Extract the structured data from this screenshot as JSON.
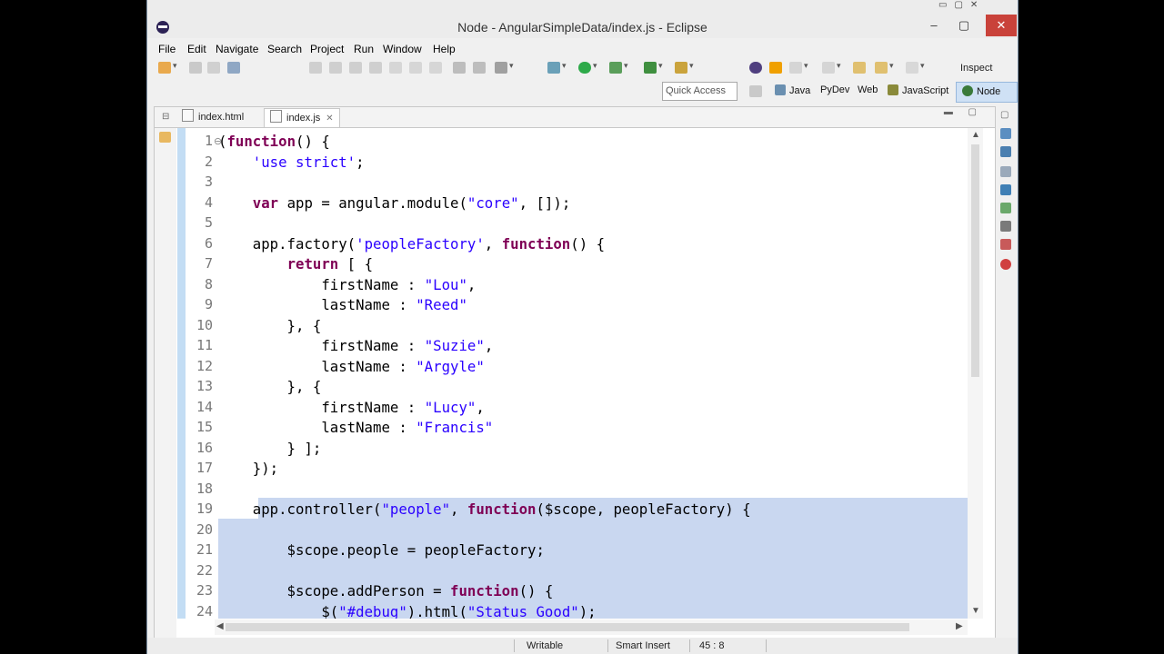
{
  "window": {
    "title": "Node - AngularSimpleData/index.js - Eclipse"
  },
  "menu": [
    "File",
    "Edit",
    "Navigate",
    "Search",
    "Project",
    "Run",
    "Window",
    "Help"
  ],
  "toolbar": {
    "inspect_label": "Inspect",
    "quick_access_placeholder": "Quick Access",
    "perspectives": [
      "Java",
      "PyDev",
      "Web",
      "JavaScript",
      "Node"
    ],
    "active_perspective": "Node"
  },
  "editor": {
    "tabs": [
      "index.html",
      "index.js"
    ],
    "active_tab": "index.js",
    "line_numbers": [
      "1",
      "2",
      "3",
      "4",
      "5",
      "6",
      "7",
      "8",
      "9",
      "10",
      "11",
      "12",
      "13",
      "14",
      "15",
      "16",
      "17",
      "18",
      "19",
      "20",
      "21",
      "22",
      "23",
      "24"
    ],
    "code_lines": [
      "(function() {",
      "    'use strict';",
      "",
      "    var app = angular.module(\"core\", []);",
      "",
      "    app.factory('peopleFactory', function() {",
      "        return [ {",
      "            firstName : \"Lou\",",
      "            lastName : \"Reed\"",
      "        }, {",
      "            firstName : \"Suzie\",",
      "            lastName : \"Argyle\"",
      "        }, {",
      "            firstName : \"Lucy\",",
      "            lastName : \"Francis\"",
      "        } ];",
      "    });",
      "",
      "    app.controller(\"people\", function($scope, peopleFactory) {",
      "",
      "        $scope.people = peopleFactory;",
      "",
      "        $scope.addPerson = function() {",
      "            $(\"#debug\").html(\"Status Good\");"
    ],
    "selected_from_line": "19"
  },
  "status": {
    "writable": "Writable",
    "insert_mode": "Smart Insert",
    "cursor_position": "45 : 8"
  },
  "colors": {
    "keyword": "#7f0055",
    "string": "#2a00ff",
    "selection": "#c9d7f0",
    "close_button": "#c9423a"
  }
}
